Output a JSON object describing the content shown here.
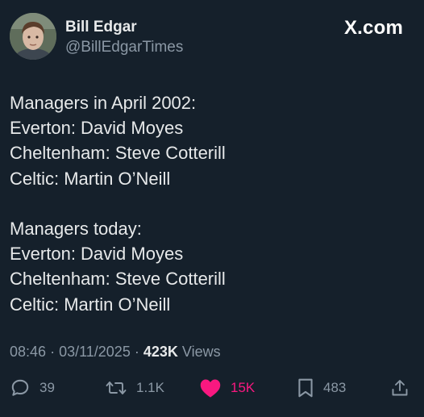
{
  "author": {
    "display_name": "Bill Edgar",
    "handle": "@BillEdgarTimes",
    "avatar_icon": "profile-photo"
  },
  "brand": {
    "label": "X.com"
  },
  "tweet": {
    "lines": [
      "Managers in April 2002:",
      "Everton: David Moyes",
      "Cheltenham: Steve Cotterill",
      "Celtic: Martin O’Neill",
      "",
      "Managers today:",
      "Everton: David Moyes",
      "Cheltenham: Steve Cotterill",
      "Celtic: Martin O’Neill"
    ]
  },
  "meta": {
    "time": "08:46",
    "date": "03/11/2025",
    "separator": "·",
    "views_count": "423K",
    "views_label": "Views"
  },
  "actions": {
    "reply": {
      "icon": "reply-icon",
      "count": "39"
    },
    "retweet": {
      "icon": "retweet-icon",
      "count": "1.1K"
    },
    "like": {
      "icon": "heart-icon",
      "count": "15K",
      "active": true,
      "color": "#f91880"
    },
    "bookmark": {
      "icon": "bookmark-icon",
      "count": "483"
    },
    "share": {
      "icon": "share-icon"
    }
  },
  "colors": {
    "background": "#15202b",
    "primary_text": "#e7e9ea",
    "secondary_text": "#8b98a5",
    "like_active": "#f91880"
  }
}
